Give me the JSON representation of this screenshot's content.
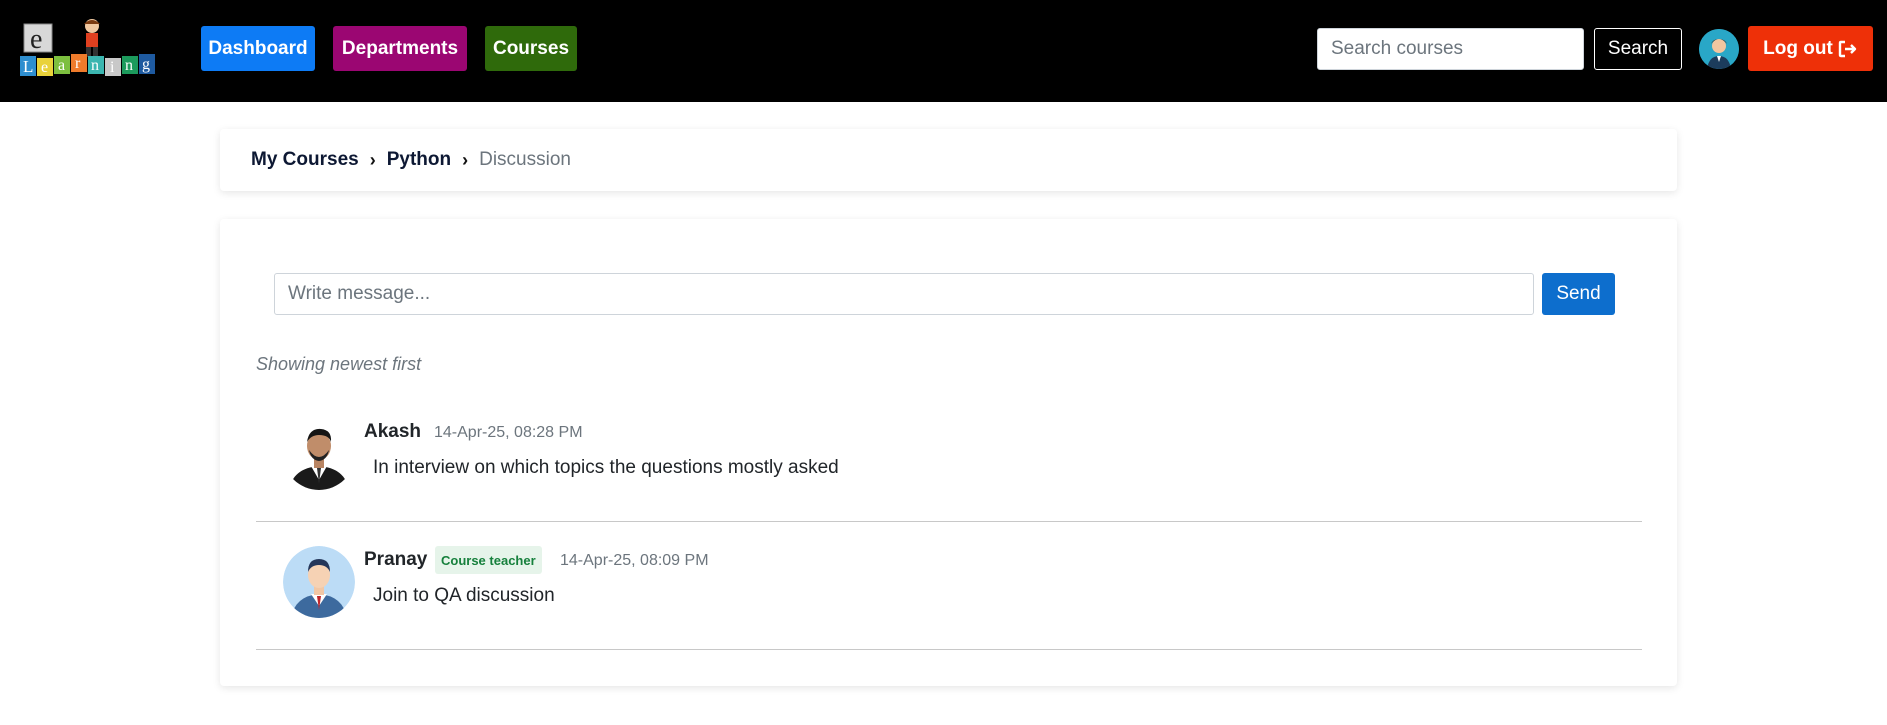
{
  "logo": {
    "letters": [
      "e",
      "L",
      "e",
      "a",
      "r",
      "n",
      "i",
      "n",
      "g"
    ]
  },
  "nav": {
    "dashboard": "Dashboard",
    "departments": "Departments",
    "courses": "Courses"
  },
  "search": {
    "placeholder": "Search courses",
    "button": "Search"
  },
  "user": {
    "avatar_icon": "user-avatar-icon"
  },
  "logout": {
    "label": "Log out",
    "icon": "logout-icon"
  },
  "breadcrumb": {
    "items": [
      "My Courses",
      "Python",
      "Discussion"
    ],
    "separator": "›"
  },
  "discussion": {
    "input_placeholder": "Write message...",
    "send_label": "Send",
    "sort_note": "Showing newest first",
    "posts": [
      {
        "author": "Akash",
        "badge": "",
        "time": "14-Apr-25, 08:28 PM",
        "text": "In interview on which topics the questions mostly asked"
      },
      {
        "author": "Pranay",
        "badge": "Course teacher",
        "time": "14-Apr-25, 08:09 PM",
        "text": "Join to QA discussion"
      }
    ]
  },
  "colors": {
    "topbar": "#000000",
    "dashboard": "#0d7bf5",
    "departments": "#9b0672",
    "courses": "#2f6a0b",
    "logout": "#ee3008",
    "send": "#0d6ecd",
    "badge_bg": "#e6f4ea",
    "badge_text": "#16803c"
  }
}
